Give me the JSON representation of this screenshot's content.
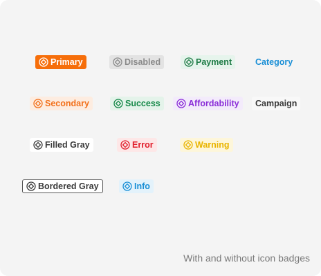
{
  "badges": {
    "primary": "Primary",
    "disabled": "Disabled",
    "payment": "Payment",
    "category": "Category",
    "secondary": "Secondary",
    "success": "Success",
    "affordability": "Affordability",
    "campaign": "Campaign",
    "filled_gray": "Filled Gray",
    "error": "Error",
    "warning": "Warning",
    "bordered_gray": "Bordered Gray",
    "info": "Info"
  },
  "icon": "diamond-in-circle-icon",
  "caption": "With and without icon badges",
  "colors": {
    "primary": "#f66e0a",
    "payment": "#1d7b45",
    "category": "#1a8fd6",
    "affordability": "#8b2fd8",
    "error": "#e11d2a",
    "warning": "#e9b400"
  }
}
